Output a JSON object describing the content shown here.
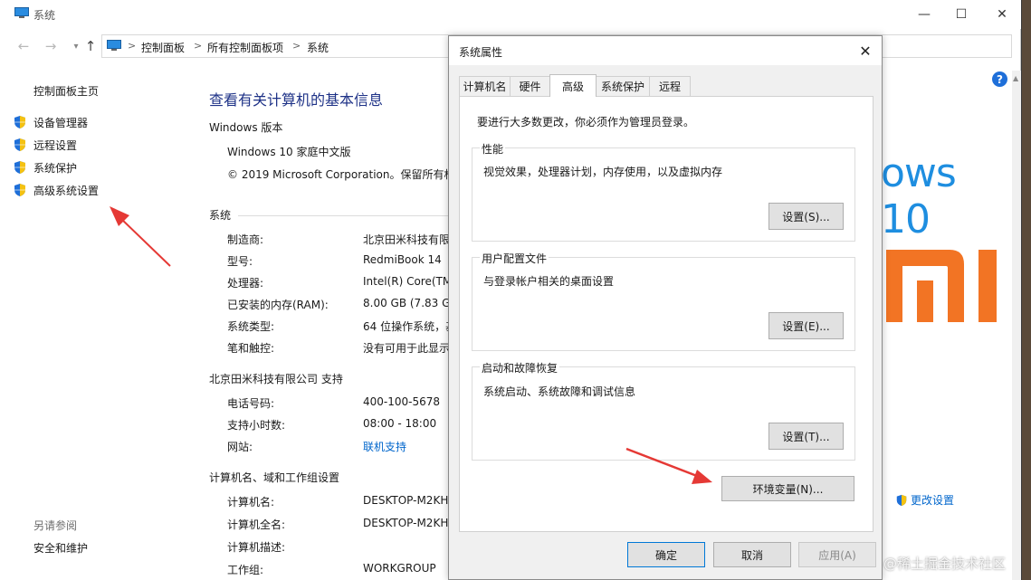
{
  "window": {
    "title": "系统",
    "minimize_glyph": "—",
    "maximize_glyph": "☐",
    "close_glyph": "✕"
  },
  "address_bar": {
    "breadcrumbs": [
      "控制面板",
      "所有控制面板项",
      "系统"
    ],
    "separator": ">"
  },
  "left_pane": {
    "home": "控制面板主页",
    "items": [
      "设备管理器",
      "远程设置",
      "系统保护",
      "高级系统设置"
    ],
    "see_also": "另请参阅",
    "see_also_items": [
      "安全和维护"
    ]
  },
  "main": {
    "title": "查看有关计算机的基本信息",
    "edition_header": "Windows 版本",
    "edition": "Windows 10 家庭中文版",
    "copyright": "© 2019 Microsoft Corporation。保留所有权",
    "windows_logo": "ows 10",
    "system_header": "系统",
    "system_rows": [
      {
        "k": "制造商:",
        "v": "北京田米科技有限"
      },
      {
        "k": "型号:",
        "v": "RedmiBook 14"
      },
      {
        "k": "处理器:",
        "v": "Intel(R) Core(TM"
      },
      {
        "k": "已安装的内存(RAM):",
        "v": "8.00 GB (7.83 GE"
      },
      {
        "k": "系统类型:",
        "v": "64 位操作系统，基"
      },
      {
        "k": "笔和触控:",
        "v": "没有可用于此显示"
      }
    ],
    "support_header": "北京田米科技有限公司 支持",
    "support_rows": [
      {
        "k": "电话号码:",
        "v": "400-100-5678"
      },
      {
        "k": "支持小时数:",
        "v": "08:00 - 18:00"
      },
      {
        "k": "网站:",
        "v": "联机支持"
      }
    ],
    "computer_header": "计算机名、域和工作组设置",
    "computer_rows": [
      {
        "k": "计算机名:",
        "v": "DESKTOP-M2KH"
      },
      {
        "k": "计算机全名:",
        "v": "DESKTOP-M2KH"
      },
      {
        "k": "计算机描述:",
        "v": ""
      },
      {
        "k": "工作组:",
        "v": "WORKGROUP"
      }
    ],
    "change_settings": "更改设置"
  },
  "dialog": {
    "title": "系统属性",
    "tabs": [
      "计算机名",
      "硬件",
      "高级",
      "系统保护",
      "远程"
    ],
    "active_tab": "高级",
    "admin_note": "要进行大多数更改，你必须作为管理员登录。",
    "performance": {
      "title": "性能",
      "desc": "视觉效果，处理器计划，内存使用，以及虚拟内存",
      "button": "设置(S)..."
    },
    "profiles": {
      "title": "用户配置文件",
      "desc": "与登录帐户相关的桌面设置",
      "button": "设置(E)..."
    },
    "startup": {
      "title": "启动和故障恢复",
      "desc": "系统启动、系统故障和调试信息",
      "button": "设置(T)..."
    },
    "env_button": "环境变量(N)...",
    "ok": "确定",
    "cancel": "取消",
    "apply": "应用(A)"
  },
  "watermark": "@稀土掘金技术社区",
  "colors": {
    "title_blue": "#1e3287",
    "link_blue": "#0066cc",
    "windows_blue": "#1e8ee0",
    "mi_orange": "#f27424",
    "arrow_red": "#e53935"
  }
}
